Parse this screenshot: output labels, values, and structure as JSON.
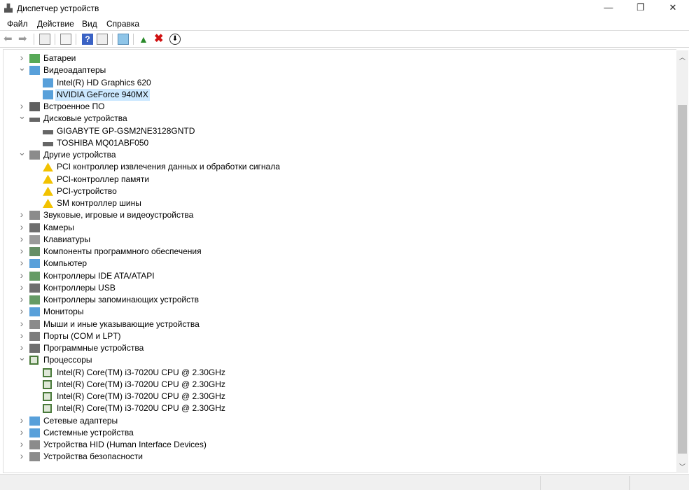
{
  "window": {
    "title": "Диспетчер устройств",
    "minimize": "—",
    "restore": "❐",
    "close": "✕"
  },
  "menu": [
    "Файл",
    "Действие",
    "Вид",
    "Справка"
  ],
  "toolbar": [
    "back-icon",
    "forward-icon",
    "properties-icon",
    "show-hidden-icon",
    "help-icon",
    "action-icon",
    "scan-hardware-icon",
    "update-driver-icon",
    "uninstall-icon",
    "disable-icon"
  ],
  "tree": [
    {
      "label": "Батареи",
      "level": 0,
      "exp": "collapsed",
      "icon": "battery",
      "color": "#3a9a3a"
    },
    {
      "label": "Видеоадаптеры",
      "level": 0,
      "exp": "expanded",
      "icon": "display",
      "color": "#3b8fd4"
    },
    {
      "label": "Intel(R) HD Graphics 620",
      "level": 1,
      "icon": "display",
      "color": "#3b8fd4"
    },
    {
      "label": "NVIDIA GeForce 940MX",
      "level": 1,
      "icon": "display",
      "color": "#3b8fd4",
      "selected": true
    },
    {
      "label": "Встроенное ПО",
      "level": 0,
      "exp": "collapsed",
      "icon": "chip",
      "color": "#444"
    },
    {
      "label": "Дисковые устройства",
      "level": 0,
      "exp": "expanded",
      "icon": "disk",
      "color": "#666"
    },
    {
      "label": "GIGABYTE GP-GSM2NE3128GNTD",
      "level": 1,
      "icon": "disk",
      "color": "#666"
    },
    {
      "label": "TOSHIBA MQ01ABF050",
      "level": 1,
      "icon": "disk",
      "color": "#666"
    },
    {
      "label": "Другие устройства",
      "level": 0,
      "exp": "expanded",
      "icon": "unknown",
      "color": "#777"
    },
    {
      "label": "PCI контроллер извлечения данных и обработки сигнала",
      "level": 1,
      "icon": "warning",
      "color": "#e8b400"
    },
    {
      "label": "PCI-контроллер памяти",
      "level": 1,
      "icon": "warning",
      "color": "#e8b400"
    },
    {
      "label": "PCI-устройство",
      "level": 1,
      "icon": "warning",
      "color": "#e8b400"
    },
    {
      "label": "SM контроллер шины",
      "level": 1,
      "icon": "warning",
      "color": "#e8b400"
    },
    {
      "label": "Звуковые, игровые и видеоустройства",
      "level": 0,
      "exp": "collapsed",
      "icon": "speaker",
      "color": "#777"
    },
    {
      "label": "Камеры",
      "level": 0,
      "exp": "collapsed",
      "icon": "camera",
      "color": "#555"
    },
    {
      "label": "Клавиатуры",
      "level": 0,
      "exp": "collapsed",
      "icon": "keyboard",
      "color": "#888"
    },
    {
      "label": "Компоненты программного обеспечения",
      "level": 0,
      "exp": "collapsed",
      "icon": "component",
      "color": "#4a7a4a"
    },
    {
      "label": "Компьютер",
      "level": 0,
      "exp": "collapsed",
      "icon": "monitor",
      "color": "#3b8fd4"
    },
    {
      "label": "Контроллеры IDE ATA/ATAPI",
      "level": 0,
      "exp": "collapsed",
      "icon": "ide",
      "color": "#4a8a4a"
    },
    {
      "label": "Контроллеры USB",
      "level": 0,
      "exp": "collapsed",
      "icon": "usb",
      "color": "#555"
    },
    {
      "label": "Контроллеры запоминающих устройств",
      "level": 0,
      "exp": "collapsed",
      "icon": "storage",
      "color": "#4a8a4a"
    },
    {
      "label": "Мониторы",
      "level": 0,
      "exp": "collapsed",
      "icon": "monitor",
      "color": "#3b8fd4"
    },
    {
      "label": "Мыши и иные указывающие устройства",
      "level": 0,
      "exp": "collapsed",
      "icon": "mouse",
      "color": "#777"
    },
    {
      "label": "Порты (COM и LPT)",
      "level": 0,
      "exp": "collapsed",
      "icon": "port",
      "color": "#666"
    },
    {
      "label": "Программные устройства",
      "level": 0,
      "exp": "collapsed",
      "icon": "software",
      "color": "#555"
    },
    {
      "label": "Процессоры",
      "level": 0,
      "exp": "expanded",
      "icon": "cpu",
      "color": "#4a7a3a"
    },
    {
      "label": "Intel(R) Core(TM) i3-7020U CPU @ 2.30GHz",
      "level": 1,
      "icon": "cpu",
      "color": "#4a7a3a"
    },
    {
      "label": "Intel(R) Core(TM) i3-7020U CPU @ 2.30GHz",
      "level": 1,
      "icon": "cpu",
      "color": "#4a7a3a"
    },
    {
      "label": "Intel(R) Core(TM) i3-7020U CPU @ 2.30GHz",
      "level": 1,
      "icon": "cpu",
      "color": "#4a7a3a"
    },
    {
      "label": "Intel(R) Core(TM) i3-7020U CPU @ 2.30GHz",
      "level": 1,
      "icon": "cpu",
      "color": "#4a7a3a"
    },
    {
      "label": "Сетевые адаптеры",
      "level": 0,
      "exp": "collapsed",
      "icon": "network",
      "color": "#3b8fd4"
    },
    {
      "label": "Системные устройства",
      "level": 0,
      "exp": "collapsed",
      "icon": "system",
      "color": "#3b8fd4"
    },
    {
      "label": "Устройства HID (Human Interface Devices)",
      "level": 0,
      "exp": "collapsed",
      "icon": "hid",
      "color": "#777"
    },
    {
      "label": "Устройства безопасности",
      "level": 0,
      "exp": "collapsed",
      "icon": "security",
      "color": "#777"
    }
  ]
}
